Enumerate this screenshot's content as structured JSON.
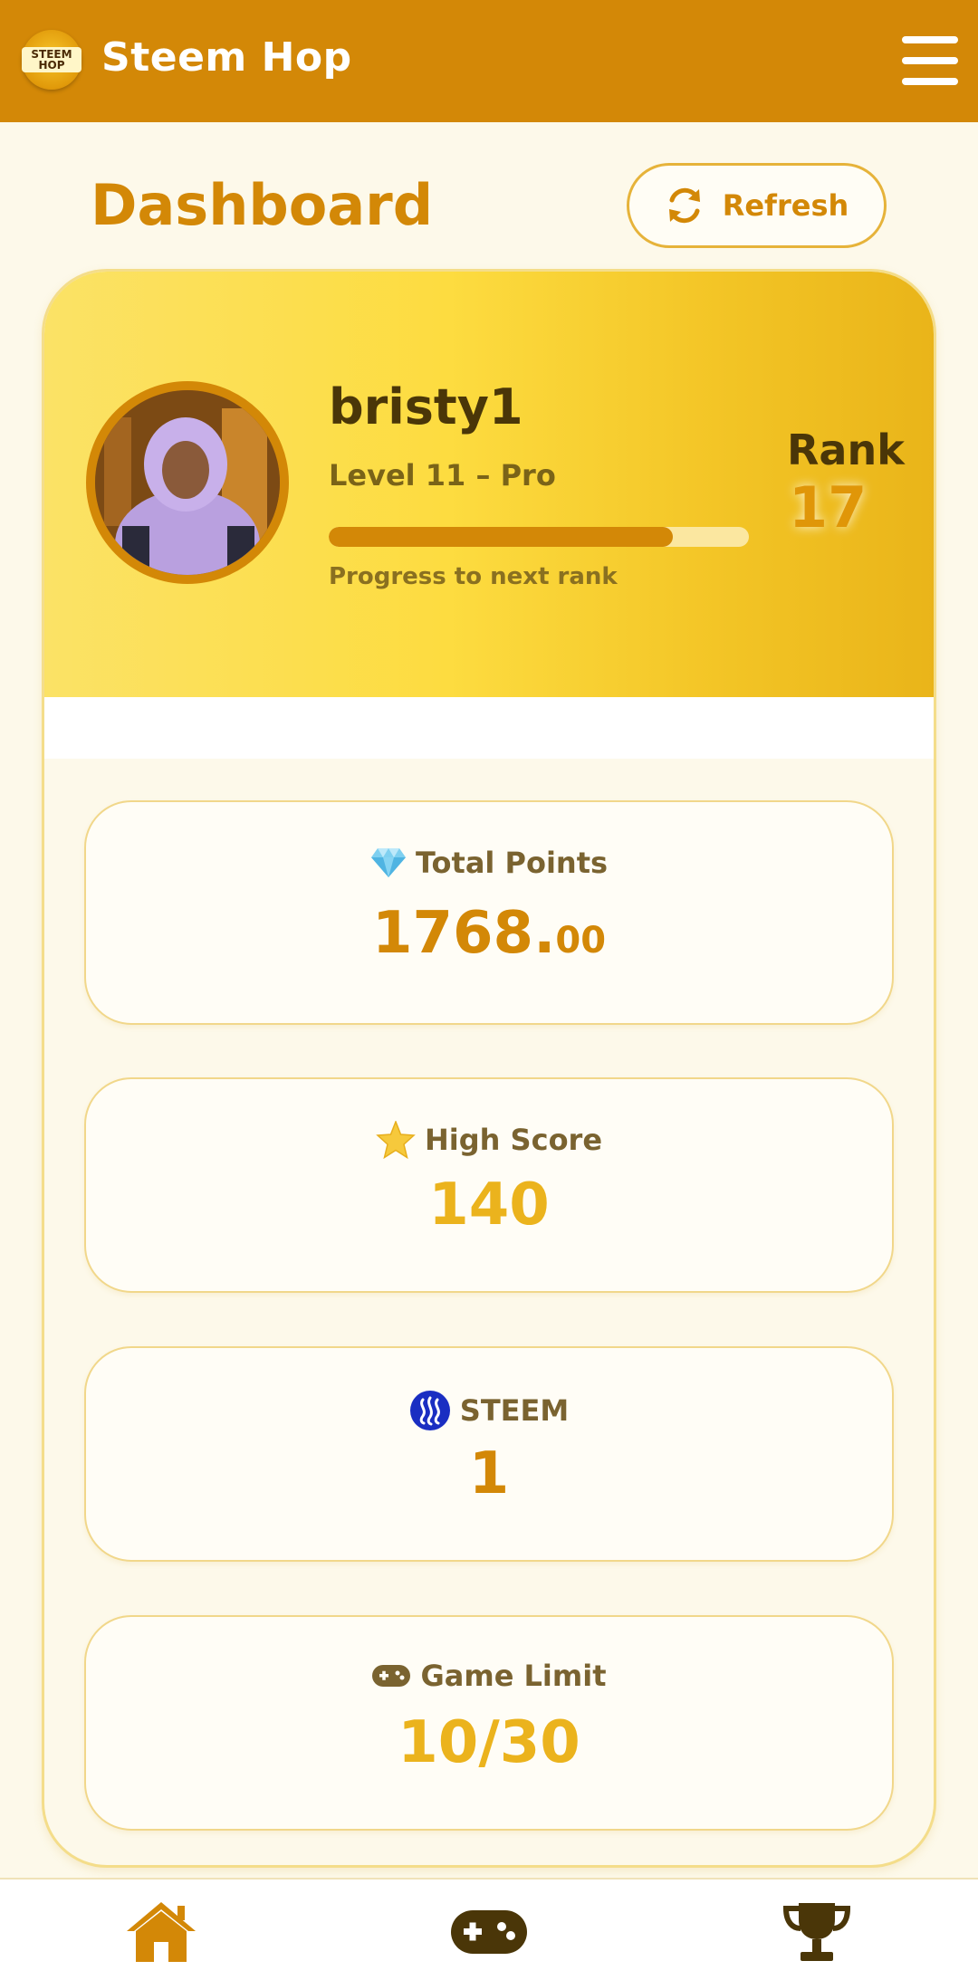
{
  "header": {
    "logo_text": "STEEM HOP",
    "app_title": "Steem Hop",
    "menu_icon": "hamburger-menu-icon"
  },
  "page": {
    "title": "Dashboard",
    "refresh_label": "Refresh",
    "refresh_icon": "refresh-icon"
  },
  "profile": {
    "username": "bristy1",
    "level_text": "Level 11 – Pro",
    "progress_fraction": 0.82,
    "progress_label": "Progress to next rank",
    "rank_label": "Rank",
    "rank_value": "17"
  },
  "stats": {
    "total_points": {
      "icon": "diamond-icon",
      "label": "Total Points",
      "value_int": "1768.",
      "value_dec": "00"
    },
    "high_score": {
      "icon": "star-icon",
      "label": "High Score",
      "value": "140"
    },
    "steem": {
      "icon": "steem-logo-icon",
      "label": "STEEM",
      "value": "1"
    },
    "game_limit": {
      "icon": "gamepad-icon",
      "label": "Game Limit",
      "value": "10/30"
    }
  },
  "bottom_nav": [
    {
      "icon": "home-icon"
    },
    {
      "icon": "gamepad-icon"
    },
    {
      "icon": "trophy-icon"
    }
  ],
  "colors": {
    "brand_orange": "#d38807",
    "gold": "#ebb31d",
    "background": "#fdf9ea",
    "dark_brown": "#4a3608"
  }
}
